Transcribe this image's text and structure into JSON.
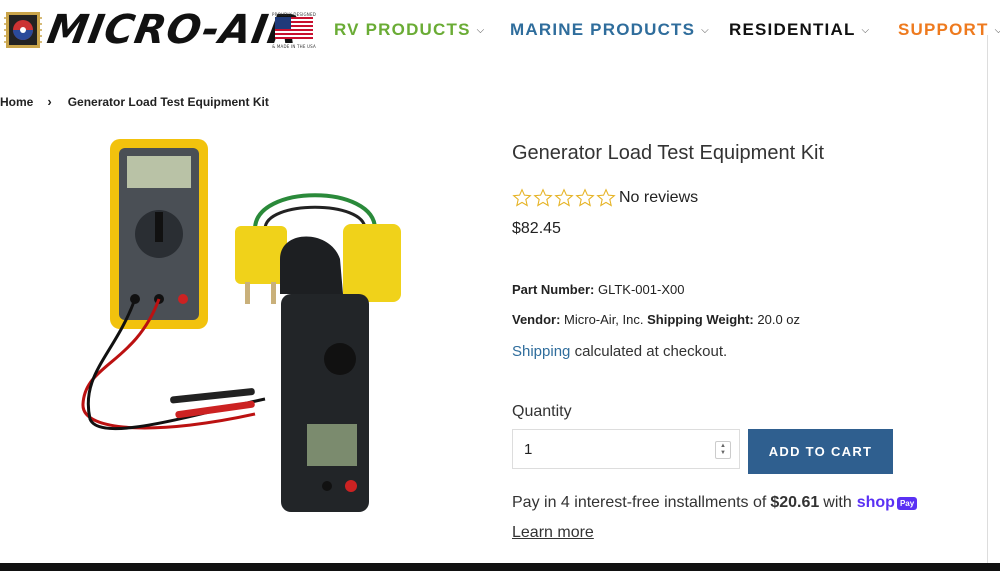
{
  "header": {
    "logo_text": "MICRO-AIR",
    "flag_top": "PROUDLY DESIGNED",
    "flag_bottom": "& MADE IN THE USA",
    "nav": [
      {
        "label": "RV PRODUCTS"
      },
      {
        "label": "MARINE PRODUCTS"
      },
      {
        "label": "RESIDENTIAL"
      },
      {
        "label": "SUPPORT"
      }
    ]
  },
  "breadcrumb": {
    "home": "Home",
    "separator": "›",
    "current": "Generator Load Test Equipment Kit"
  },
  "product": {
    "title": "Generator Load Test Equipment Kit",
    "reviews_text": "No reviews",
    "rating": 0,
    "price": "$82.45",
    "part_number_label": "Part Number:",
    "part_number": "GLTK-001-X00",
    "vendor_label": "Vendor:",
    "vendor": "Micro-Air, Inc.",
    "shipping_weight_label": "Shipping Weight:",
    "shipping_weight": "20.0 oz",
    "shipping_link": "Shipping",
    "shipping_text": "calculated at checkout.",
    "quantity_label": "Quantity",
    "quantity_value": "1",
    "add_to_cart": "ADD TO CART",
    "installments_prefix": "Pay in 4 interest-free installments of",
    "installment_amount": "$20.61",
    "installments_with": "with",
    "shop_pay_shop": "shop",
    "shop_pay_badge": "Pay",
    "learn_more": "Learn more"
  },
  "colors": {
    "rv": "#6aac35",
    "marine": "#2f6d9c",
    "support": "#ee7a1e",
    "button": "#2f5f8f",
    "shop_pay": "#5a31f4"
  }
}
